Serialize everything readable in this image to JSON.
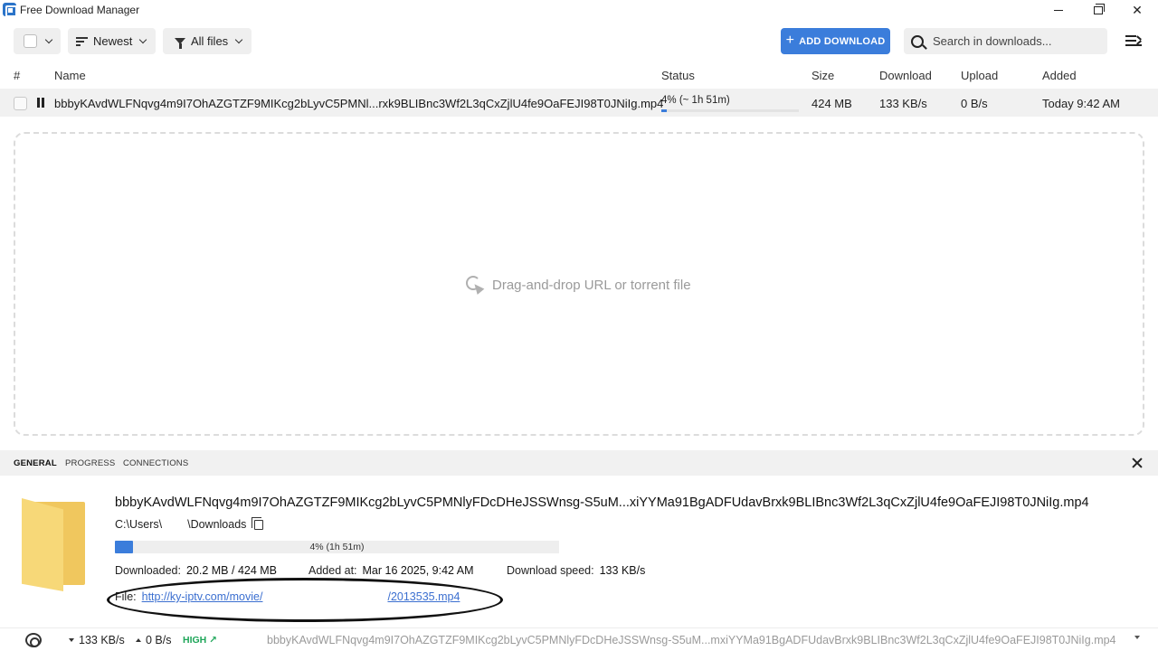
{
  "window": {
    "title": "Free Download Manager",
    "minimize": "minimize-icon",
    "maximize": "restore-icon",
    "close": "close-icon"
  },
  "toolbar": {
    "sort_label": "Newest",
    "filter_label": "All files",
    "add_label": "ADD DOWNLOAD",
    "search_placeholder": "Search in downloads...",
    "accent_color": "#3b7ddb"
  },
  "columns": {
    "num": "#",
    "name": "Name",
    "status": "Status",
    "size": "Size",
    "download": "Download",
    "upload": "Upload",
    "added": "Added"
  },
  "downloads": [
    {
      "name": "bbbyKAvdWLFNqvg4m9I7OhAZGTZF9MIKcg2bLyvC5PMNl...rxk9BLIBnc3Wf2L3qCxZjlU4fe9OaFEJI98T0JNiIg.mp4",
      "status": "4% (~ 1h 51m)",
      "progress_percent": 4,
      "size": "424 MB",
      "download_speed": "133 KB/s",
      "upload_speed": "0 B/s",
      "added": "Today 9:42 AM"
    }
  ],
  "dropzone": {
    "text": "Drag-and-drop URL or torrent file"
  },
  "details": {
    "tabs": [
      "GENERAL",
      "PROGRESS",
      "CONNECTIONS"
    ],
    "active_tab": "GENERAL",
    "file_name": "bbbyKAvdWLFNqvg4m9I7OhAZGTZF9MIKcg2bLyvC5PMNlyFDcDHeJSSWnsg-S5uM...xiYYMa91BgADFUdavBrxk9BLIBnc3Wf2L3qCxZjlU4fe9OaFEJI98T0JNiIg.mp4",
    "path_prefix": "C:\\Users\\",
    "path_suffix": "\\Downloads",
    "progress_text": "4% (1h 51m)",
    "progress_percent": 4,
    "downloaded_label": "Downloaded:",
    "downloaded_value": "20.2 MB / 424 MB",
    "added_label": "Added at:",
    "added_value": "Mar 16 2025, 9:42 AM",
    "speed_label": "Download speed:",
    "speed_value": "133 KB/s",
    "file_label": "File:",
    "file_url_start": "http://ky-iptv.com/movie/",
    "file_url_end": "/2013535.mp4"
  },
  "statusbar": {
    "download_speed": "133 KB/s",
    "upload_speed": "0 B/s",
    "priority": "HIGH ↗",
    "current_file": "bbbyKAvdWLFNqvg4m9I7OhAZGTZF9MIKcg2bLyvC5PMNlyFDcDHeJSSWnsg-S5uM...mxiYYMa91BgADFUdavBrxk9BLIBnc3Wf2L3qCxZjlU4fe9OaFEJI98T0JNiIg.mp4"
  }
}
